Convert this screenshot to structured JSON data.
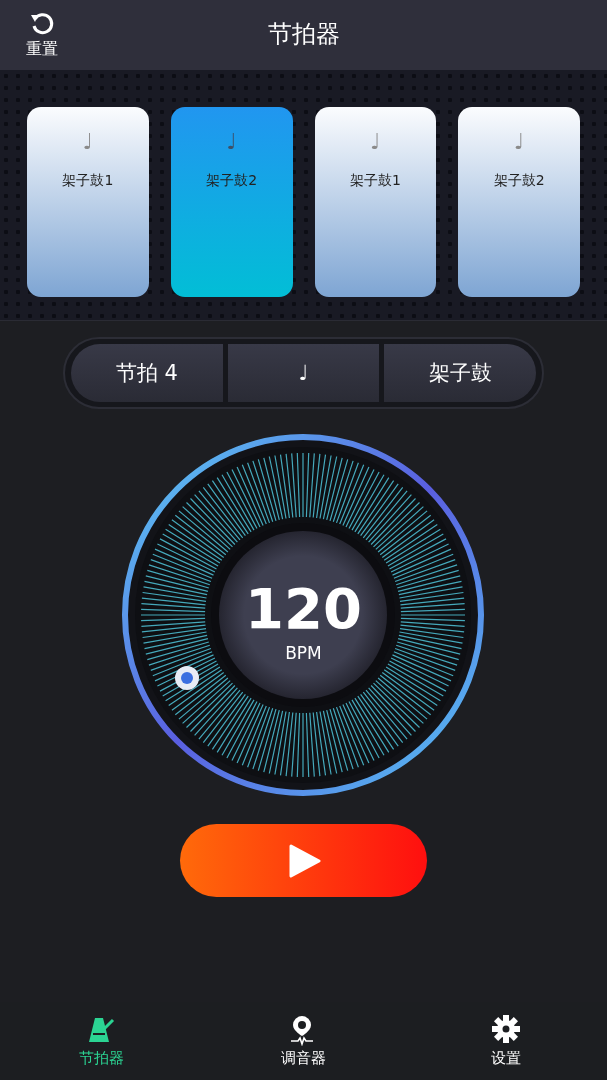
{
  "header": {
    "reset_label": "重置",
    "title": "节拍器"
  },
  "sounds": [
    {
      "note": "♩",
      "label": "架子鼓1",
      "selected": false
    },
    {
      "note": "♩",
      "label": "架子鼓2",
      "selected": true
    },
    {
      "note": "♩",
      "label": "架子鼓1",
      "selected": false
    },
    {
      "note": "♩",
      "label": "架子鼓2",
      "selected": false
    }
  ],
  "segments": [
    {
      "label": "节拍 4"
    },
    {
      "label": "♩"
    },
    {
      "label": "架子鼓"
    }
  ],
  "dial": {
    "value": "120",
    "unit": "BPM"
  },
  "nav": [
    {
      "kind": "metronome",
      "label": "节拍器",
      "selected": true
    },
    {
      "kind": "tuner",
      "label": "调音器",
      "selected": false
    },
    {
      "kind": "settings",
      "label": "设置",
      "selected": false
    }
  ]
}
